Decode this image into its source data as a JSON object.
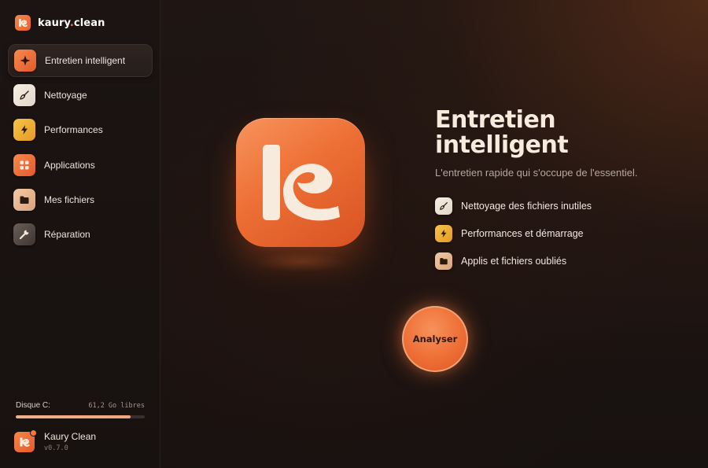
{
  "brand": {
    "name_main": "kaury",
    "name_dot": ".",
    "name_suffix": "clean",
    "logo_icon": "k-logo-icon"
  },
  "sidebar": {
    "items": [
      {
        "label": "Entretien intelligent",
        "icon": "sparkle-icon",
        "active": true
      },
      {
        "label": "Nettoyage",
        "icon": "broom-icon",
        "active": false
      },
      {
        "label": "Performances",
        "icon": "lightning-icon",
        "active": false
      },
      {
        "label": "Applications",
        "icon": "grid-icon",
        "active": false
      },
      {
        "label": "Mes fichiers",
        "icon": "folder-icon",
        "active": false
      },
      {
        "label": "Réparation",
        "icon": "wrench-icon",
        "active": false
      }
    ],
    "disk": {
      "label": "Disque C:",
      "free": "61,2 Go libres",
      "used_fraction": 0.89
    },
    "account": {
      "name": "Kaury Clean",
      "version": "v0.7.0"
    }
  },
  "main": {
    "title_line1": "Entretien",
    "title_line2": "intelligent",
    "subtitle": "L'entretien rapide qui s'occupe de l'essentiel.",
    "features": [
      {
        "label": "Nettoyage des fichiers inutiles",
        "icon": "broom-icon"
      },
      {
        "label": "Performances et démarrage",
        "icon": "lightning-icon"
      },
      {
        "label": "Applis et fichiers oubliés",
        "icon": "folder-icon"
      }
    ],
    "action_label": "Analyser"
  },
  "colors": {
    "accent": "#ee6f36",
    "cream": "#f6ebdd",
    "background": "#1a1311"
  }
}
